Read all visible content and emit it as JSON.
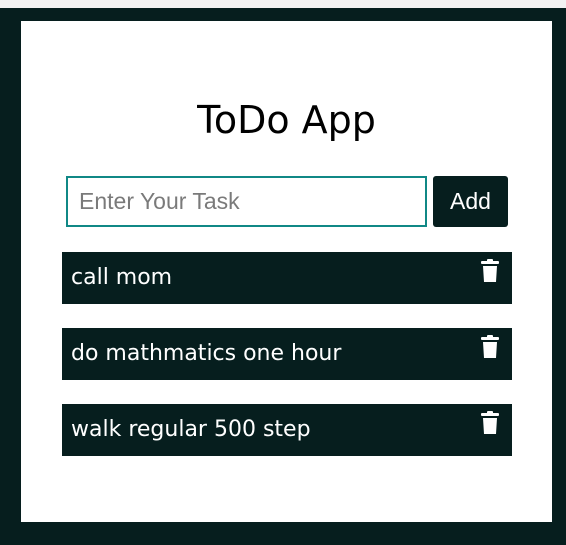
{
  "app": {
    "title": "ToDo App"
  },
  "input": {
    "placeholder": "Enter Your Task",
    "value": ""
  },
  "add_button": {
    "label": "Add"
  },
  "tasks": [
    {
      "text": "call mom",
      "delete_icon": "trash-icon"
    },
    {
      "text": "do mathmatics one hour",
      "delete_icon": "trash-icon"
    },
    {
      "text": "walk regular 500 step",
      "delete_icon": "trash-icon"
    }
  ],
  "colors": {
    "frame": "#061e1e",
    "card": "#ffffff",
    "input_border": "#108886",
    "task_bg": "#061e1e",
    "task_text": "#ffffff"
  }
}
